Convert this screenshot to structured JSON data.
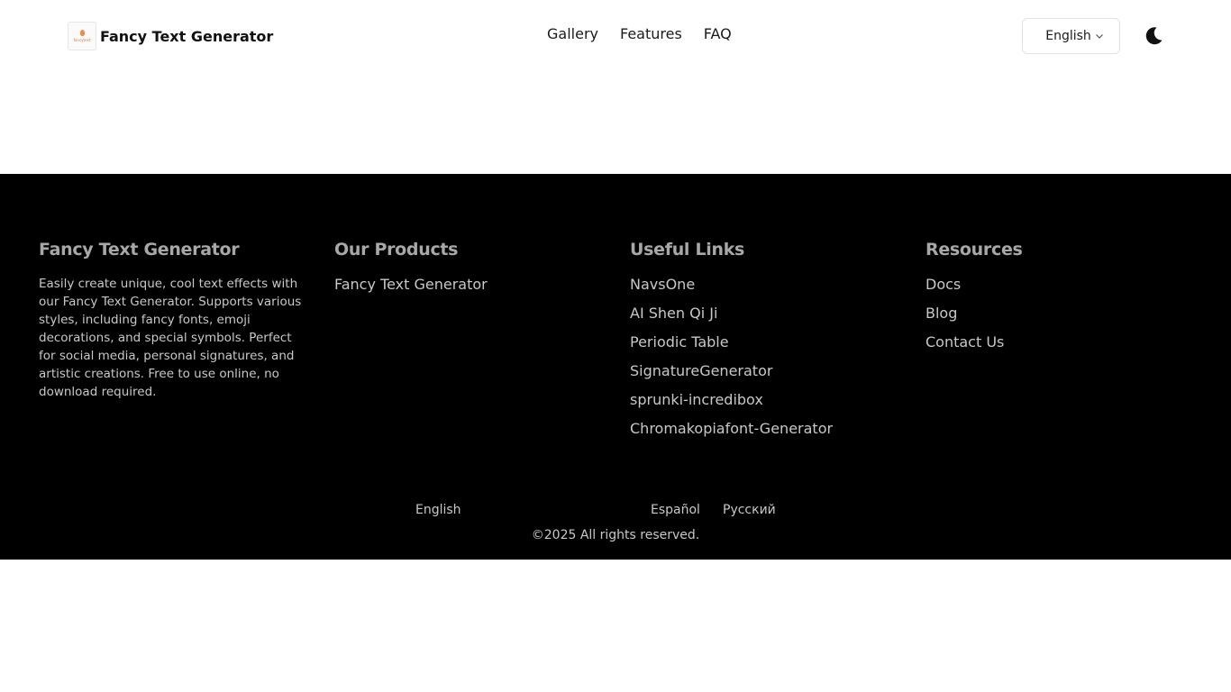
{
  "header": {
    "logo_tiny_text": "fancytext",
    "brand": "Fancy Text Generator",
    "nav": [
      "Gallery",
      "Features",
      "FAQ"
    ],
    "language": "English"
  },
  "footer": {
    "about": {
      "title": "Fancy Text Generator",
      "description": "Easily create unique, cool text effects with our Fancy Text Generator. Supports various styles, including fancy fonts, emoji decorations, and special symbols. Perfect for social media, personal signatures, and artistic creations. Free to use online, no download required."
    },
    "products": {
      "title": "Our Products",
      "items": [
        "Fancy Text Generator"
      ]
    },
    "useful_links": {
      "title": "Useful Links",
      "items": [
        "NavsOne",
        "AI Shen Qi Ji",
        "Periodic Table",
        "SignatureGenerator",
        "sprunki-incredibox",
        "Chromakopiafont-Generator"
      ]
    },
    "resources": {
      "title": "Resources",
      "items": [
        "Docs",
        "Blog",
        "Contact Us"
      ]
    },
    "languages": [
      "English",
      "Español",
      "Русский"
    ],
    "copyright": "©2025  All rights reserved."
  },
  "colors": {
    "footer_bg": "#000000",
    "logo_accent": "#f08a4b"
  }
}
